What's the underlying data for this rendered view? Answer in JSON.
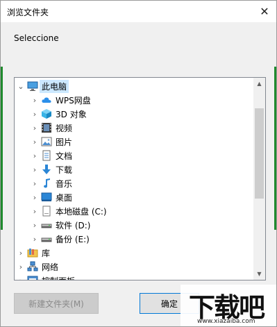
{
  "window": {
    "title": "浏览文件夹",
    "close_glyph": "✕"
  },
  "prompt": "Seleccione",
  "tree": {
    "items": [
      {
        "label": "此电脑",
        "icon": "computer-icon",
        "expand": "v",
        "indent": 0,
        "selected": true
      },
      {
        "label": "WPS网盘",
        "icon": "cloud-icon",
        "expand": ">",
        "indent": 1
      },
      {
        "label": "3D 对象",
        "icon": "3d-objects-icon",
        "expand": ">",
        "indent": 1
      },
      {
        "label": "视频",
        "icon": "video-icon",
        "expand": ">",
        "indent": 1
      },
      {
        "label": "图片",
        "icon": "pictures-icon",
        "expand": ">",
        "indent": 1
      },
      {
        "label": "文档",
        "icon": "documents-icon",
        "expand": ">",
        "indent": 1
      },
      {
        "label": "下载",
        "icon": "download-icon",
        "expand": ">",
        "indent": 1
      },
      {
        "label": "音乐",
        "icon": "music-icon",
        "expand": ">",
        "indent": 1
      },
      {
        "label": "桌面",
        "icon": "desktop-icon",
        "expand": ">",
        "indent": 1
      },
      {
        "label": "本地磁盘 (C:)",
        "icon": "local-disk-icon",
        "expand": ">",
        "indent": 1
      },
      {
        "label": "软件 (D:)",
        "icon": "drive-icon",
        "expand": ">",
        "indent": 1
      },
      {
        "label": "备份 (E:)",
        "icon": "drive-icon",
        "expand": ">",
        "indent": 1
      },
      {
        "label": "库",
        "icon": "library-icon",
        "expand": ">",
        "indent": 0
      },
      {
        "label": "网络",
        "icon": "network-icon",
        "expand": ">",
        "indent": 0
      },
      {
        "label": "控制面板",
        "icon": "control-panel-icon",
        "expand": ">",
        "indent": 0
      }
    ]
  },
  "buttons": {
    "new_folder": "新建文件夹(M)",
    "ok": "确定"
  },
  "watermark": {
    "main": "下载吧",
    "sub": "www.xiazaiba.com"
  },
  "colors": {
    "selection": "#cce8ff",
    "accent": "#0078d7"
  }
}
